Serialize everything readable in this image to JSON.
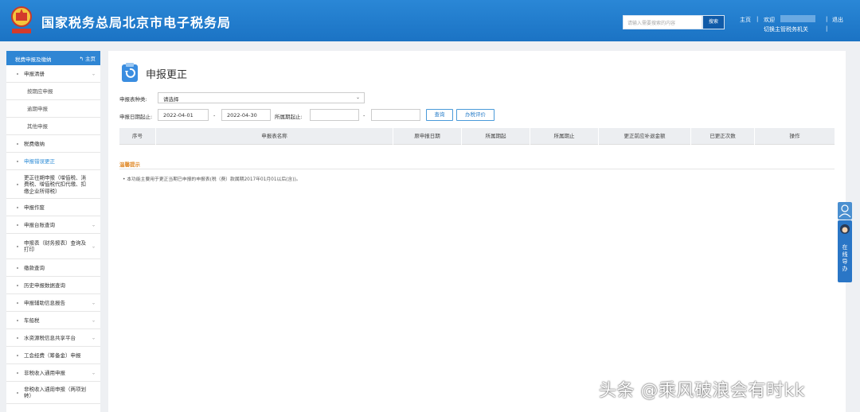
{
  "header": {
    "site_title": "国家税务总局北京市电子税务局",
    "search_placeholder": "请输入需要搜索的内容",
    "search_button": "搜索",
    "home_link": "主页",
    "separator": "|",
    "welcome_label": "欢迎",
    "logout_link": "退出",
    "switch_agency": "切换主管税务机关",
    "brand_color": "#1b73c4"
  },
  "sidebar": {
    "title": "税费申报及缴纳",
    "home_link": "主页",
    "items": [
      {
        "label": "申报清册",
        "expandable": true
      },
      {
        "label": "按期应申报",
        "sub": true
      },
      {
        "label": "逾期申报",
        "sub": true
      },
      {
        "label": "其他申报",
        "sub": true
      },
      {
        "label": "税费缴纳",
        "expandable": false
      },
      {
        "label": "申报错误更正",
        "expandable": false,
        "active": true
      },
      {
        "label": "更正往期申报（增值税、消费税、增值税代扣代缴、扣缴企业所得税）",
        "expandable": false
      },
      {
        "label": "申报作废",
        "expandable": false
      },
      {
        "label": "申报台账查询",
        "expandable": true
      },
      {
        "label": "申报表（财务报表）查询及打印",
        "expandable": true
      },
      {
        "label": "缴款查询",
        "expandable": false
      },
      {
        "label": "历史申报数据查询",
        "expandable": false
      },
      {
        "label": "申报辅助信息报告",
        "expandable": true
      },
      {
        "label": "车船税",
        "expandable": true
      },
      {
        "label": "水资源税信息共享平台",
        "expandable": true
      },
      {
        "label": "工会经费（筹备金）申报",
        "expandable": false
      },
      {
        "label": "非税收入通用申报",
        "expandable": true
      },
      {
        "label": "非税收入通用申报（两项划转）",
        "expandable": false
      }
    ]
  },
  "main": {
    "page_title": "申报更正",
    "form": {
      "report_type_label": "申报表种类:",
      "report_type_value": "请选择",
      "declare_date_label": "申报日期起止:",
      "declare_date_from": "2022-04-01",
      "dash": "-",
      "declare_date_to": "2022-04-30",
      "period_label": "所属期起止:",
      "period_from": "",
      "period_to": "",
      "query_button": "查询",
      "evaluate_button": "办税评价"
    },
    "table_headers": [
      "序号",
      "申报表名称",
      "原申报日期",
      "所属期起",
      "所属期止",
      "更正前应补退金额",
      "已更正次数",
      "操作"
    ],
    "tips_title": "温馨提示",
    "tips_text": "• 本功能主要用于更正当期已申报的申报表(税（费）款属期2017年01月01以后(含))。"
  },
  "float_help": {
    "label": "在线导办"
  },
  "watermark": "头条 @乘风破浪会有时kk"
}
